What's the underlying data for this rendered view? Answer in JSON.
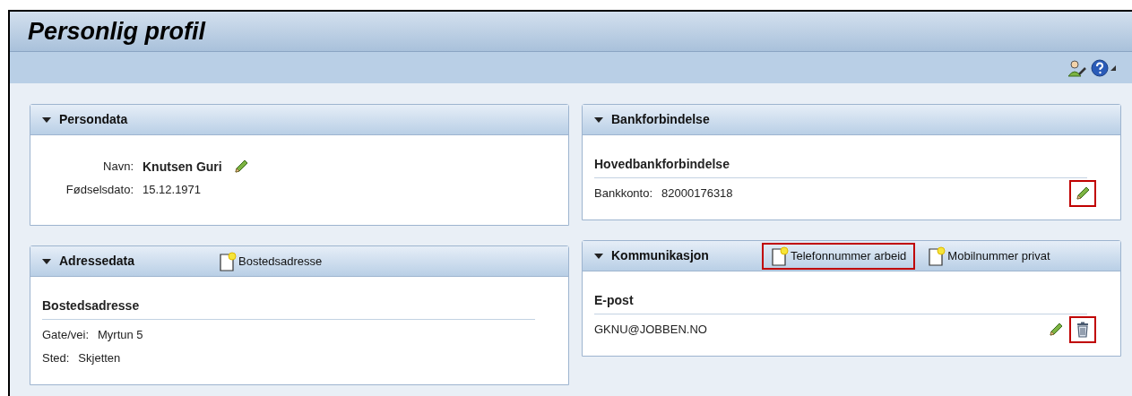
{
  "page": {
    "title": "Personlig profil"
  },
  "columns": [
    [
      {
        "title": "Persondata",
        "expanded": true,
        "rows": [
          {
            "label": "Navn:",
            "value": "Knutsen Guri",
            "bold": true,
            "tools": [
              {
                "kind": "edit",
                "highlighted": false
              }
            ]
          },
          {
            "label": "Fødselsdato:",
            "value": "15.12.1971",
            "bold": false,
            "tools": []
          }
        ]
      },
      {
        "title": "Adressedata",
        "expanded": true,
        "actions": [
          {
            "label": "Bostedsadresse",
            "highlighted": false
          }
        ],
        "heading": "Bostedsadresse",
        "rows": [
          {
            "label": "Gate/vei:",
            "value": "Myrtun 5",
            "bold": false,
            "tools": []
          },
          {
            "label": "Sted:",
            "value": "Skjetten",
            "bold": false,
            "tools": []
          }
        ]
      }
    ],
    [
      {
        "title": "Bankforbindelse",
        "expanded": true,
        "heading": "Hovedbankforbindelse",
        "rows": [
          {
            "label": "Bankkonto:",
            "value": "82000176318",
            "bold": false,
            "tools": [
              {
                "kind": "edit",
                "highlighted": true
              }
            ]
          }
        ]
      },
      {
        "title": "Kommunikasjon",
        "expanded": true,
        "actions": [
          {
            "label": "Telefonnummer arbeid",
            "highlighted": true
          },
          {
            "label": "Mobilnummer privat",
            "highlighted": false
          }
        ],
        "heading": "E-post",
        "rows": [
          {
            "value": "GKNU@JOBBEN.NO",
            "bold": false,
            "tools": [
              {
                "kind": "edit",
                "highlighted": false
              },
              {
                "kind": "delete",
                "highlighted": true
              }
            ]
          }
        ]
      }
    ]
  ]
}
